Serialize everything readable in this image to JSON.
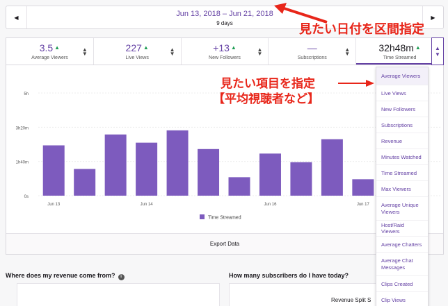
{
  "date_bar": {
    "range": "Jun 13, 2018 – Jun 21, 2018",
    "days": "9 days",
    "prev_icon": "chevron-left-icon",
    "next_icon": "chevron-right-icon"
  },
  "stats": [
    {
      "value": "3.5",
      "trend": "▲",
      "label": "Average Viewers",
      "active": false
    },
    {
      "value": "227",
      "trend": "▲",
      "label": "Live Views",
      "active": false
    },
    {
      "value": "+13",
      "trend": "▲",
      "label": "New Followers",
      "active": false
    },
    {
      "value": "—",
      "trend": "",
      "label": "Subscriptions",
      "active": false
    },
    {
      "value": "32h48m",
      "trend": "▲",
      "label": "Time Streamed",
      "active": true
    }
  ],
  "chart_data": {
    "type": "bar",
    "categories": [
      "Jun 13",
      "",
      "",
      "Jun 14",
      "",
      "",
      "",
      "Jun 16",
      "",
      "",
      "Jun 17",
      "",
      ""
    ],
    "x_tick_labels": [
      "Jun 13",
      "Jun 14",
      "Jun 16",
      "Jun 17"
    ],
    "values": [
      2.45,
      1.3,
      2.98,
      2.58,
      3.18,
      2.27,
      0.9,
      2.05,
      1.63,
      2.75,
      0.8,
      2.75,
      0
    ],
    "y_ticks": [
      "5h",
      "3h20m",
      "1h40m",
      "0s"
    ],
    "ylim": [
      0,
      5
    ],
    "legend": "Time Streamed",
    "color": "#7d5bbe"
  },
  "export_label": "Export Data",
  "bottom": {
    "revenue_title": "Where does my revenue come from?",
    "subs_title": "How many subscribers do I have today?",
    "revenue_split": "Revenue Split",
    "revenue_split_extra": "S"
  },
  "menu": {
    "items": [
      "Average Viewers",
      "Live Views",
      "New Followers",
      "Subscriptions",
      "Revenue",
      "Minutes Watched",
      "Time Streamed",
      "Max Viewers",
      "Average Unique Viewers",
      "Host/Raid Viewers",
      "Average Chatters",
      "Average Chat Messages",
      "Clips Created",
      "Clip Views"
    ]
  },
  "annotations": {
    "date_note": "見たい日付を区間指定",
    "metric_note": "見たい項目を指定",
    "metric_note2": "【平均視聴者など】",
    "color": "#e8261a"
  },
  "colors": {
    "accent": "#6441a4",
    "bar": "#7d5bbe",
    "up": "#1f9d55"
  }
}
